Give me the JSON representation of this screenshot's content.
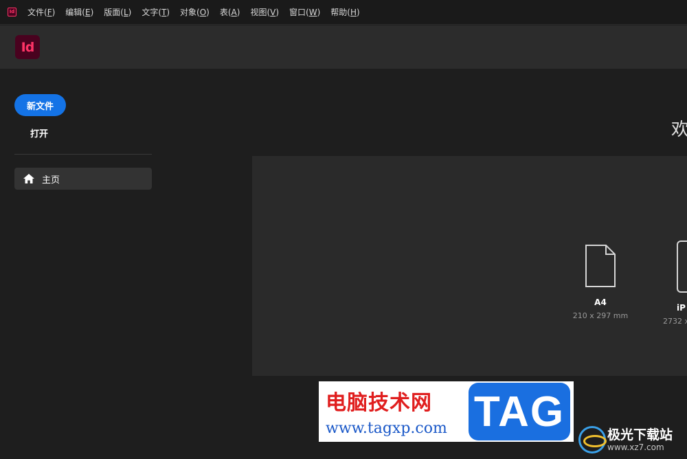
{
  "menubar": {
    "app_icon_text": "Id",
    "items": [
      {
        "label": "文件(",
        "key": "F",
        "close": ")"
      },
      {
        "label": "编辑(",
        "key": "E",
        "close": ")"
      },
      {
        "label": "版面(",
        "key": "L",
        "close": ")"
      },
      {
        "label": "文字(",
        "key": "T",
        "close": ")"
      },
      {
        "label": "对象(",
        "key": "O",
        "close": ")"
      },
      {
        "label": "表(",
        "key": "A",
        "close": ")"
      },
      {
        "label": "视图(",
        "key": "V",
        "close": ")"
      },
      {
        "label": "窗口(",
        "key": "W",
        "close": ")"
      },
      {
        "label": "帮助(",
        "key": "H",
        "close": ")"
      }
    ]
  },
  "header": {
    "logo_text": "Id"
  },
  "sidebar": {
    "new_file_label": "新文件",
    "open_label": "打开",
    "home_label": "主页",
    "home_icon": "home-icon"
  },
  "main": {
    "welcome_text": "欢",
    "presets": [
      {
        "name": "A4",
        "dims": "210 x 297 mm",
        "icon": "document-icon"
      },
      {
        "name": "iP",
        "dims": "2732 x",
        "icon": "tablet-icon"
      }
    ]
  },
  "watermark": {
    "cn_text": "电脑技术网",
    "url_text": "www.tagxp.com",
    "tag_text": "TAG",
    "site2_title": "极光下载站",
    "site2_url": "www.xz7.com"
  },
  "colors": {
    "accent": "#1473e6",
    "app_brand": "#ff3366",
    "app_brand_bg": "#49021f"
  }
}
